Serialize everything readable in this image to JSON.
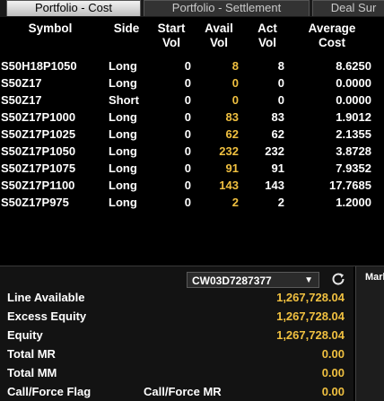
{
  "tabs": [
    "Portfolio - Cost",
    "Portfolio - Settlement",
    "Deal Sur"
  ],
  "columns": {
    "symbol": "Symbol",
    "side": "Side",
    "start_vol": [
      "Start",
      "Vol"
    ],
    "avail_vol": [
      "Avail",
      "Vol"
    ],
    "act_vol": [
      "Act",
      "Vol"
    ],
    "avg_cost": [
      "Average",
      "Cost"
    ]
  },
  "positions": [
    {
      "symbol": "S50H18P1050",
      "side": "Long",
      "start": "0",
      "avail": "8",
      "act": "8",
      "avg": "8.6250"
    },
    {
      "symbol": "S50Z17",
      "side": "Long",
      "start": "0",
      "avail": "0",
      "act": "0",
      "avg": "0.0000"
    },
    {
      "symbol": "S50Z17",
      "side": "Short",
      "start": "0",
      "avail": "0",
      "act": "0",
      "avg": "0.0000"
    },
    {
      "symbol": "S50Z17P1000",
      "side": "Long",
      "start": "0",
      "avail": "83",
      "act": "83",
      "avg": "1.9012"
    },
    {
      "symbol": "S50Z17P1025",
      "side": "Long",
      "start": "0",
      "avail": "62",
      "act": "62",
      "avg": "2.1355"
    },
    {
      "symbol": "S50Z17P1050",
      "side": "Long",
      "start": "0",
      "avail": "232",
      "act": "232",
      "avg": "3.8728"
    },
    {
      "symbol": "S50Z17P1075",
      "side": "Long",
      "start": "0",
      "avail": "91",
      "act": "91",
      "avg": "7.9352"
    },
    {
      "symbol": "S50Z17P1100",
      "side": "Long",
      "start": "0",
      "avail": "143",
      "act": "143",
      "avg": "17.7685"
    },
    {
      "symbol": "S50Z17P975",
      "side": "Long",
      "start": "0",
      "avail": "2",
      "act": "2",
      "avg": "1.2000"
    }
  ],
  "account": {
    "selected": "CW03D7287377",
    "arrow": "▼"
  },
  "right_panel_label": "Mark",
  "summary": {
    "line_available": {
      "label": "Line Available",
      "value": "1,267,728.04"
    },
    "excess_equity": {
      "label": "Excess Equity",
      "value": "1,267,728.04"
    },
    "equity": {
      "label": "Equity",
      "value": "1,267,728.04"
    },
    "total_mr": {
      "label": "Total MR",
      "value": "0.00"
    },
    "total_mm": {
      "label": "Total MM",
      "value": "0.00"
    },
    "call_force": {
      "label": "Call/Force Flag",
      "label2": "Call/Force MR",
      "value": "0.00"
    }
  },
  "colors": {
    "highlight": "#f0c040",
    "background": "#000000"
  },
  "icons": {
    "refresh": "refresh-icon",
    "dropdown": "chevron-down-icon"
  }
}
